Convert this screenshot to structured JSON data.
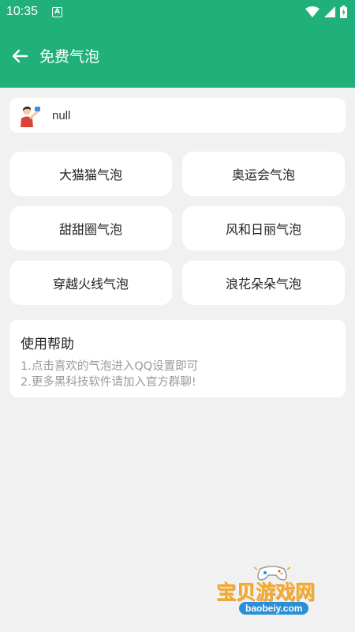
{
  "status": {
    "time": "10:35"
  },
  "appbar": {
    "title": "免费气泡"
  },
  "user": {
    "name": "null"
  },
  "bubbles": [
    {
      "label": "大猫猫气泡"
    },
    {
      "label": "奥运会气泡"
    },
    {
      "label": "甜甜圈气泡"
    },
    {
      "label": "风和日丽气泡"
    },
    {
      "label": "穿越火线气泡"
    },
    {
      "label": "浪花朵朵气泡"
    }
  ],
  "help": {
    "title": "使用帮助",
    "lines": [
      "1.点击喜欢的气泡进入QQ设置即可",
      "2.更多黑科技软件请加入官方群聊!"
    ]
  },
  "watermark": {
    "title": "宝贝游戏网",
    "url": "baobeiy.com"
  },
  "colors": {
    "primary": "#20b07a",
    "background": "#f1f1f1"
  }
}
